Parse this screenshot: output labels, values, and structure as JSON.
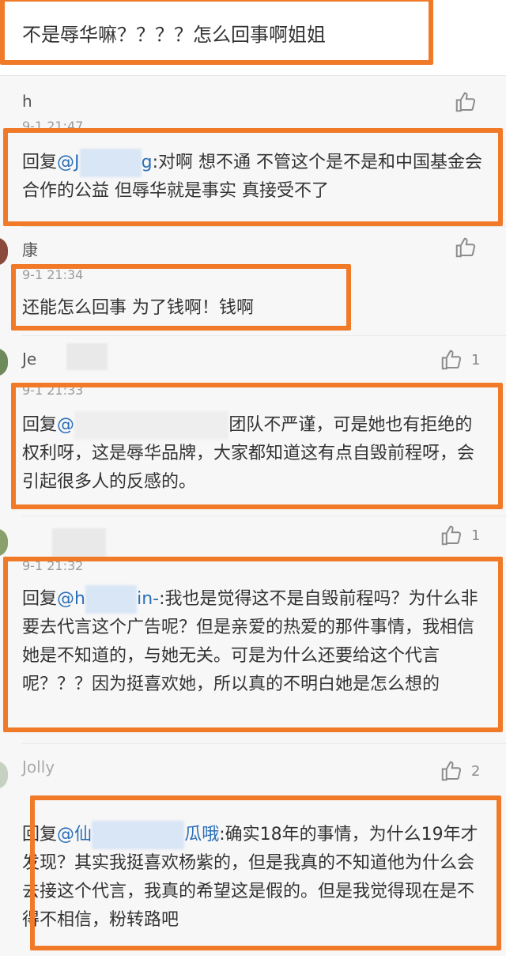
{
  "top_comment": {
    "text": "不是辱华嘛？？？？怎么回事啊姐姐"
  },
  "comments": [
    {
      "user": "h",
      "time": "9-1 21:47",
      "likes": "",
      "reply_prefix": "回复",
      "mention_start": "@J",
      "mention_end": "g",
      "text": ":对啊 想不通 不管这个是不是和中国基金会合作的公益 但辱华就是事实 真接受不了"
    },
    {
      "user": "康",
      "time": "9-1 21:34",
      "likes": "",
      "text": "还能怎么回事 为了钱啊！钱啊"
    },
    {
      "user": "Je",
      "time": "9-1 21:33",
      "likes": "1",
      "reply_prefix": "回复",
      "mention_start": "@",
      "text": "团队不严谨，可是她也有拒绝的权利呀，这是辱华品牌，大家都知道这有点自毁前程呀，会引起很多人的反感的。"
    },
    {
      "user": "",
      "time": "9-1 21:32",
      "likes": "1",
      "reply_prefix": "回复",
      "mention_start": "@h",
      "mention_end": "in-",
      "text": ":我也是觉得这不是自毁前程吗？为什么非要去代言这个广告呢？但是亲爱的热爱的那件事情，我相信她是不知道的，与她无关。可是为什么还要给这个代言呢？？？因为挺喜欢她，所以真的不明白她是怎么想的"
    },
    {
      "user": "Jolly",
      "time": "",
      "likes": "2",
      "reply_prefix": "回复",
      "mention_start": "@仙",
      "mention_end": "瓜哦",
      "text": ":确实18年的事情，为什么19年才发现？其实我挺喜欢杨紫的，但是我真的不知道他为什么会去接这个代言，我真的希望这是假的。但是我觉得现在是不得不相信，粉转路吧"
    }
  ],
  "colors": {
    "highlight": "#f07a28",
    "mention": "#2b6fb8",
    "text": "#333333",
    "time": "#9a9a9a"
  }
}
